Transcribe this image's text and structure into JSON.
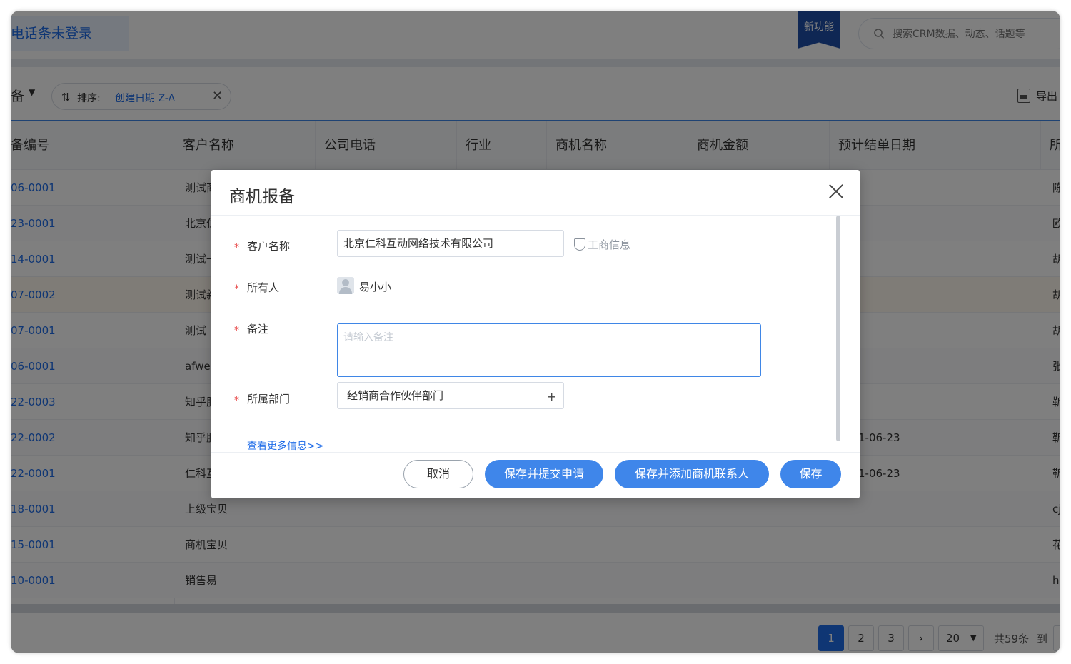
{
  "header": {
    "phone_status": "电话条未登录",
    "new_feature": "新功能",
    "search_placeholder": "搜索CRM数据、动态、话题等"
  },
  "toolbar": {
    "view_prefix": "备",
    "sort_label": "排序:",
    "sort_value": "创建日期 Z-A",
    "export_label": "导出"
  },
  "table": {
    "columns": [
      "备编号",
      "客户名称",
      "公司电话",
      "行业",
      "商机名称",
      "商机金额",
      "预计结单日期",
      "所"
    ],
    "rows": [
      {
        "id": "06-0001",
        "customer": "测试商",
        "date": "",
        "owner": "陈"
      },
      {
        "id": "23-0001",
        "customer": "北京仁",
        "date": "",
        "owner": "欧"
      },
      {
        "id": "14-0001",
        "customer": "测试一",
        "date": "",
        "owner": "胡"
      },
      {
        "id": "07-0002",
        "customer": "测试新",
        "date": "",
        "owner": "胡"
      },
      {
        "id": "07-0001",
        "customer": "测试",
        "date": "",
        "owner": "胡"
      },
      {
        "id": "06-0001",
        "customer": "afwe",
        "date": "",
        "owner": "张"
      },
      {
        "id": "22-0003",
        "customer": "知乎股",
        "date": "",
        "owner": "靳"
      },
      {
        "id": "22-0002",
        "customer": "知乎股",
        "date": "1-06-23",
        "owner": "靳"
      },
      {
        "id": "22-0001",
        "customer": "仁科互",
        "date": "1-06-23",
        "owner": "靳"
      },
      {
        "id": "18-0001",
        "customer": "上级宝贝",
        "date": "",
        "owner": "cj"
      },
      {
        "id": "15-0001",
        "customer": "商机宝贝",
        "date": "",
        "owner": "花"
      },
      {
        "id": "10-0001",
        "customer": "销售易",
        "date": "",
        "owner": "hg"
      }
    ]
  },
  "pagination": {
    "pages": [
      "1",
      "2",
      "3"
    ],
    "next": "›",
    "page_size": "20",
    "total": "共59条",
    "goto": "到"
  },
  "modal": {
    "title": "商机报备",
    "fields": {
      "customer_label": "客户名称",
      "customer_value": "北京仁科互动网络技术有限公司",
      "biz_info": "工商信息",
      "owner_label": "所有人",
      "owner_value": "易小小",
      "remark_label": "备注",
      "remark_placeholder": "请输入备注",
      "dept_label": "所属部门",
      "dept_value": "经销商合作伙伴部门"
    },
    "required_mark": "*",
    "more_info": "查看更多信息>>",
    "buttons": {
      "cancel": "取消",
      "save_submit": "保存并提交申请",
      "save_add_contact": "保存并添加商机联系人",
      "save": "保存"
    }
  },
  "colors": {
    "accent": "#1f6ce8",
    "primary_button": "#3f86ea",
    "required": "#e84a4a",
    "badge": "#1f4fa8"
  }
}
